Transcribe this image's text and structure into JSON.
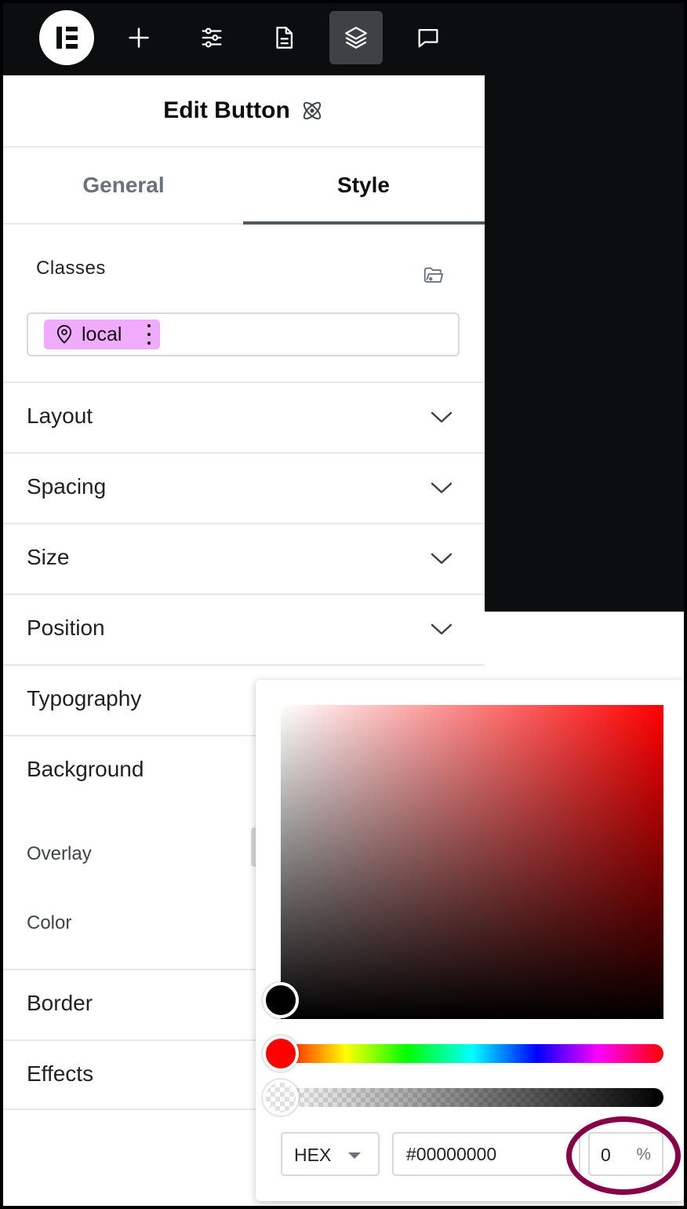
{
  "toolbar": {
    "logo": "elementor-logo",
    "items": [
      {
        "icon": "plus-icon",
        "active": false
      },
      {
        "icon": "sliders-icon",
        "active": false
      },
      {
        "icon": "document-icon",
        "active": false
      },
      {
        "icon": "layers-icon",
        "active": true
      },
      {
        "icon": "comment-icon",
        "active": false
      }
    ]
  },
  "panel": {
    "title": "Edit Button",
    "tabs": [
      {
        "label": "General",
        "active": false
      },
      {
        "label": "Style",
        "active": true
      }
    ],
    "classes": {
      "label": "Classes",
      "chip_label": "local",
      "chip_color": "#f0abfc"
    },
    "sections": [
      {
        "label": "Layout"
      },
      {
        "label": "Spacing"
      },
      {
        "label": "Size"
      },
      {
        "label": "Position"
      },
      {
        "label": "Typography"
      },
      {
        "label": "Background"
      },
      {
        "label": "Border"
      },
      {
        "label": "Effects"
      }
    ],
    "background": {
      "overlay_label": "Overlay",
      "color_label": "Color"
    }
  },
  "color_picker": {
    "format": "HEX",
    "hex_value": "#00000000",
    "alpha_value": "0",
    "alpha_unit": "%",
    "hue": "#ff0000",
    "highlight_color": "#870046"
  }
}
